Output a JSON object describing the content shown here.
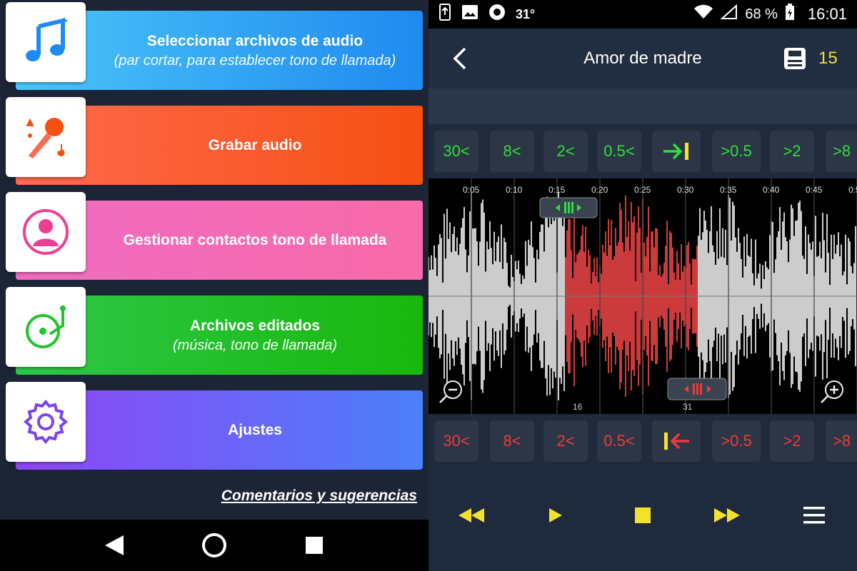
{
  "colors": {
    "blue_grad": [
      "#4cc5f8",
      "#1f8af0"
    ],
    "orange_grad": [
      "#ff6a4f",
      "#f65012"
    ],
    "pink_grad": [
      "#f06cc2",
      "#f86aa8"
    ],
    "green_grad": [
      "#2ec74a",
      "#18b80c"
    ],
    "purple_grad": [
      "#8f45f5",
      "#4b80fa"
    ],
    "accent_yellow": "#f2e22d",
    "seek_green": "#2ee03a",
    "seek_red": "#ef3a3a",
    "selection_red": "#ff4a4a"
  },
  "menu": {
    "items": [
      {
        "title": "Seleccionar archivos de audio",
        "subtitle": "(par cortar, para establecer tono de llamada)",
        "icon": "music-note-icon"
      },
      {
        "title": "Grabar audio",
        "subtitle": "",
        "icon": "microphone-icon"
      },
      {
        "title": "Gestionar contactos tono de llamada",
        "subtitle": "",
        "icon": "contact-icon"
      },
      {
        "title": "Archivos editados",
        "subtitle": "(música, tono de llamada)",
        "icon": "turntable-icon"
      },
      {
        "title": "Ajustes",
        "subtitle": "",
        "icon": "gear-icon"
      }
    ],
    "feedback": "Comentarios y sugerencias"
  },
  "status": {
    "temperature": "31°",
    "battery": "68 %",
    "time": "16:01"
  },
  "editor": {
    "title": "Amor de madre",
    "save_count": "15",
    "start_buttons": [
      "30<",
      "8<",
      "2<",
      "0.5<",
      ">0.5",
      ">2",
      ">8"
    ],
    "end_buttons": [
      "30<",
      "8<",
      "2<",
      "0.5<",
      ">0.5",
      ">2",
      ">8"
    ],
    "timeline": [
      "0:05",
      "0:10",
      "0:15",
      "0:20",
      "0:25",
      "0:30",
      "0:35",
      "0:40",
      "0:45",
      "0:5"
    ],
    "start_marker": "16",
    "end_marker": "31",
    "selection_start_sec": 16,
    "selection_end_sec": 31
  }
}
